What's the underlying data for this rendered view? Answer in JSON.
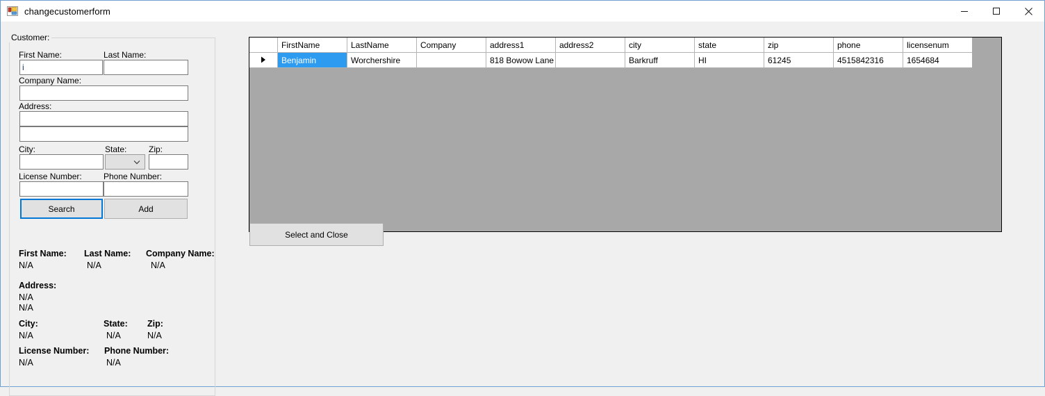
{
  "window": {
    "title": "changecustomerform",
    "icon": "windows-form-icon",
    "controls": {
      "minimize": "minimize-icon",
      "maximize": "maximize-icon",
      "close": "close-icon"
    }
  },
  "colors": {
    "accent": "#0078d7",
    "selection": "#2d9cf0",
    "window_bg": "#f0f0f0",
    "grid_bg": "#a8a8a8",
    "button_face": "#e1e1e1",
    "input_text": "#1b2f5a"
  },
  "customer_group": {
    "legend": "Customer:",
    "fields": {
      "first_name": {
        "label": "First Name:",
        "value": "i",
        "placeholder": ""
      },
      "last_name": {
        "label": "Last Name:",
        "value": "",
        "placeholder": ""
      },
      "company_name": {
        "label": "Company Name:",
        "value": "",
        "placeholder": ""
      },
      "address": {
        "label": "Address:",
        "line1": "",
        "line2": "",
        "placeholder": ""
      },
      "city": {
        "label": "City:",
        "value": "",
        "placeholder": ""
      },
      "state": {
        "label": "State:",
        "value": "",
        "options": []
      },
      "zip": {
        "label": "Zip:",
        "value": "",
        "placeholder": ""
      },
      "license_number": {
        "label": "License Number:",
        "value": "",
        "placeholder": ""
      },
      "phone_number": {
        "label": "Phone Number:",
        "value": "",
        "placeholder": ""
      }
    },
    "buttons": {
      "search": "Search",
      "add": "Add"
    }
  },
  "summary": {
    "first_name_label": "First Name:",
    "first_name_value": "N/A",
    "last_name_label": "Last Name:",
    "last_name_value": "N/A",
    "company_name_label": "Company Name:",
    "company_name_value": "N/A",
    "address_label": "Address:",
    "address_value_1": "N/A",
    "address_value_2": "N/A",
    "city_label": "City:",
    "city_value": "N/A",
    "state_label": "State:",
    "state_value": "N/A",
    "zip_label": "Zip:",
    "zip_value": "N/A",
    "license_label": "License Number:",
    "license_value": "N/A",
    "phone_label": "Phone Number:",
    "phone_value": "N/A"
  },
  "grid": {
    "row_indicator": "row-selector-arrow",
    "columns": [
      "FirstName",
      "LastName",
      "Company",
      "address1",
      "address2",
      "city",
      "state",
      "zip",
      "phone",
      "licensenum"
    ],
    "rows": [
      {
        "selected_cell": 0,
        "cells": [
          "Benjamin",
          "Worchershire",
          "",
          "818 Bowow Lane",
          "",
          "Barkruff",
          "HI",
          "61245",
          "4515842316",
          "1654684"
        ]
      }
    ]
  },
  "actions": {
    "select_and_close": "Select and Close"
  }
}
